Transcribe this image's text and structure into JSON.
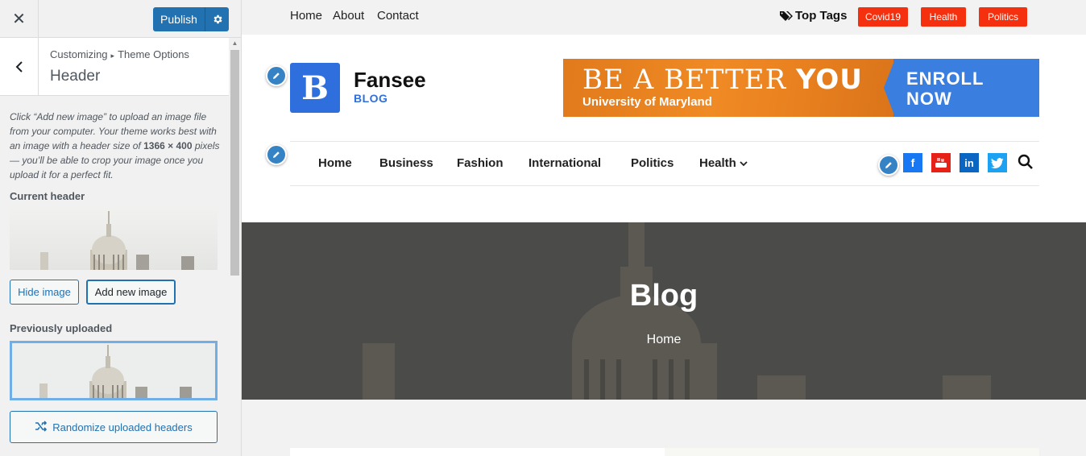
{
  "customizer": {
    "close_label": "✕",
    "publish_label": "Publish",
    "breadcrumb_root": "Customizing",
    "breadcrumb_section": "Theme Options",
    "panel_title": "Header",
    "description_pre": "Click “Add new image” to upload an image file from your computer. Your theme works best with an image with a header size of ",
    "description_size": "1366 × 400",
    "description_post": " pixels — you’ll be able to crop your image once you upload it for a perfect fit.",
    "current_header_label": "Current header",
    "hide_image_label": "Hide image",
    "add_new_image_label": "Add new image",
    "previously_uploaded_label": "Previously uploaded",
    "randomize_label": "Randomize uploaded headers"
  },
  "site": {
    "top_links": [
      "Home",
      "About",
      "Contact"
    ],
    "top_tags_label": "Top Tags",
    "tags": [
      "Covid19",
      "Health",
      "Politics"
    ],
    "logo_letter": "B",
    "name": "Fansee",
    "tagline": "BLOG",
    "ad": {
      "headline_a": "BE A BETTER ",
      "headline_b": "YOU",
      "subline": "University of Maryland",
      "cta_line1": "ENROLL",
      "cta_line2": "NOW"
    },
    "nav": [
      "Home",
      "Business",
      "Fashion",
      "International",
      "Politics",
      "Health"
    ],
    "hero_title": "Blog",
    "hero_breadcrumb": "Home"
  },
  "colors": {
    "accent": "#2271b1",
    "tag_red": "#f4300e",
    "brand_blue": "#2f6fdd",
    "facebook": "#1877f2",
    "youtube": "#e62117",
    "linkedin": "#0a66c2",
    "twitter": "#1da1f2"
  }
}
